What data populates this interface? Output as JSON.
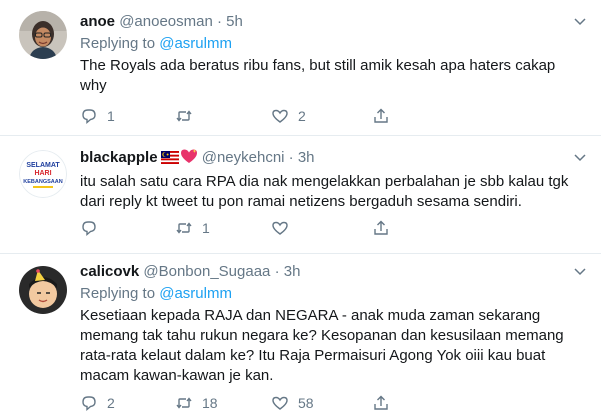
{
  "tweets": [
    {
      "name": "anoe",
      "handle": "@anoeosman",
      "time": "5h",
      "replying_prefix": "Replying to",
      "replying_to": "@asrulmm",
      "text_lines": [
        "The Royals ada beratus ribu fans, but still amik kesah apa haters cakap",
        "why"
      ],
      "reply_count": "1",
      "retweet_count": "",
      "like_count": "2"
    },
    {
      "name": "blackapple",
      "handle": "@neykehcni",
      "time": "3h",
      "avatar_text": [
        "SELAMAT",
        "HARI",
        "KEBANGSAAN"
      ],
      "text_lines": [
        "itu salah satu cara RPA dia nak mengelakkan perbalahan je sbb kalau tgk",
        "dari reply kt tweet tu pon ramai netizens bergaduh sesama sendiri."
      ],
      "reply_count": "",
      "retweet_count": "1",
      "like_count": ""
    },
    {
      "name": "calicovk",
      "handle": "@Bonbon_Sugaaa",
      "time": "3h",
      "replying_prefix": "Replying to",
      "replying_to": "@asrulmm",
      "text_lines": [
        "Kesetiaan kepada RAJA dan NEGARA - anak muda zaman sekarang",
        "memang tak tahu rukun negara ke? Kesopanan dan kesusilaan memang",
        "rata-rata kelaut dalam ke? Itu Raja Permaisuri Agong Yok oiii kau buat",
        "macam kawan-kawan je kan."
      ],
      "reply_count": "2",
      "retweet_count": "18",
      "like_count": "58"
    }
  ],
  "separator": "·",
  "colors": {
    "text": "#14171a",
    "muted": "#657786",
    "link": "#1da1f2",
    "divider": "#e6ecf0"
  },
  "icons": [
    "chevron-down-icon",
    "reply-icon",
    "retweet-icon",
    "like-icon",
    "share-icon",
    "malaysia-flag-icon",
    "sparkling-heart-icon"
  ]
}
